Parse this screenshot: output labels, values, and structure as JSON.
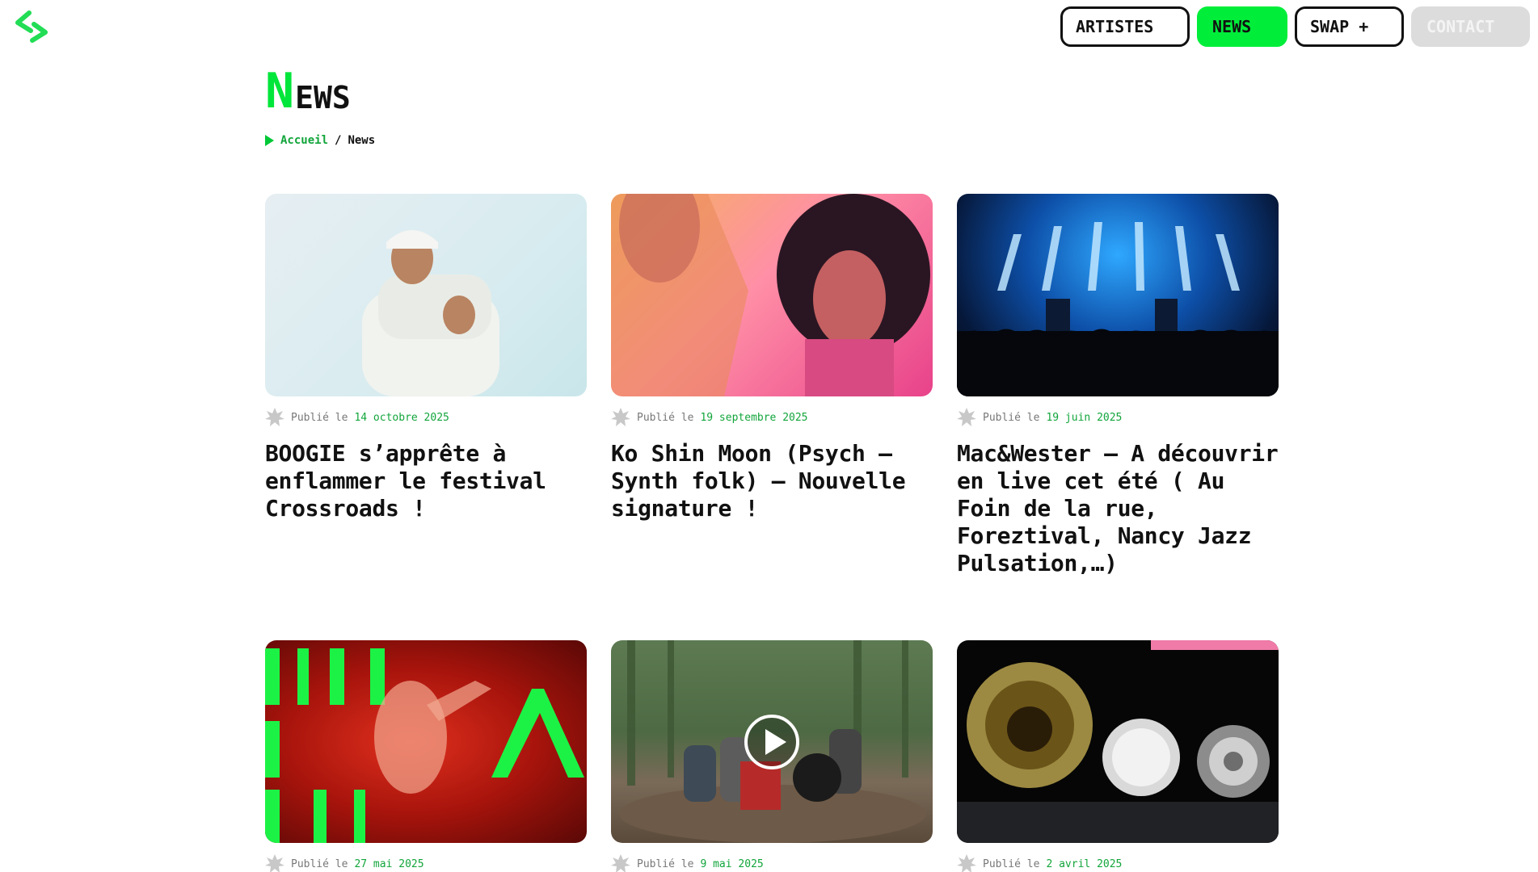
{
  "header": {
    "logo_name": "chevron-logo",
    "nav": [
      {
        "label": "ARTISTES"
      },
      {
        "label": "NEWS"
      },
      {
        "label": "SWAP +"
      },
      {
        "label": "CONTACT"
      }
    ]
  },
  "page": {
    "title_first": "N",
    "title_rest": "EWS"
  },
  "breadcrumb": {
    "home": "Accueil",
    "sep": "/",
    "current": "News"
  },
  "colors": {
    "accent": "#00ee3a",
    "link_green": "#12a53b",
    "text": "#111111",
    "contact_bg": "#dcdcdc"
  },
  "posts": [
    {
      "prefix": "Publié le",
      "date": "14 octobre 2025",
      "title": "BOOGIE s’apprête à enflammer le festival Crossroads !"
    },
    {
      "prefix": "Publié le",
      "date": "19 septembre 2025",
      "title": "Ko Shin Moon (Psych – Synth folk) – Nouvelle signature !"
    },
    {
      "prefix": "Publié le",
      "date": "19 juin 2025",
      "title": "Mac&Wester – A découvrir en live cet été ( Au Foin de la rue, Foreztival, Nancy Jazz Pulsation,…)"
    },
    {
      "prefix": "Publié le",
      "date": "27 mai 2025",
      "title": ""
    },
    {
      "prefix": "Publié le",
      "date": "9 mai 2025",
      "title": ""
    },
    {
      "prefix": "Publié le",
      "date": "2 avril 2025",
      "title": ""
    }
  ]
}
